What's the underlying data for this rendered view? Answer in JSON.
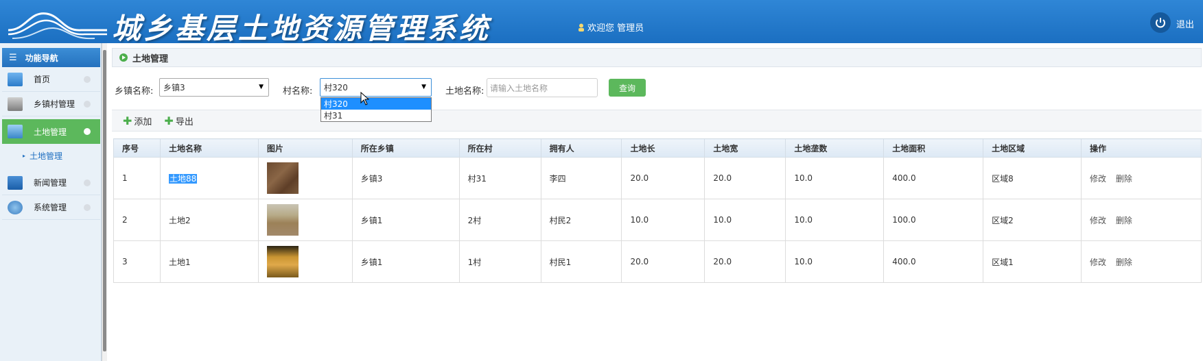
{
  "header": {
    "title": "城乡基层土地资源管理系统",
    "welcome": "欢迎您 管理员",
    "logout": "退出"
  },
  "sidebar": {
    "heading": "功能导航",
    "items": [
      {
        "label": "首页",
        "icon": "monitor-icon"
      },
      {
        "label": "乡镇村管理",
        "icon": "printer-icon"
      },
      {
        "label": "土地管理",
        "icon": "land-icon"
      },
      {
        "label": "新闻管理",
        "icon": "news-icon"
      },
      {
        "label": "系统管理",
        "icon": "settings-icon"
      }
    ],
    "sub_item": "土地管理"
  },
  "panel": {
    "title": "土地管理"
  },
  "filters": {
    "town_label": "乡镇名称:",
    "town_value": "乡镇3",
    "village_label": "村名称:",
    "village_value": "村320",
    "village_options": [
      "村320",
      "村31"
    ],
    "land_label": "土地名称:",
    "land_placeholder": "请输入土地名称",
    "query_button": "查询"
  },
  "toolbar": {
    "add": "添加",
    "export": "导出"
  },
  "table": {
    "columns": [
      "序号",
      "土地名称",
      "图片",
      "所在乡镇",
      "所在村",
      "拥有人",
      "土地长",
      "土地宽",
      "土地垄数",
      "土地面积",
      "土地区域",
      "操作"
    ],
    "rows": [
      {
        "no": "1",
        "name": "土地88",
        "town": "乡镇3",
        "village": "村31",
        "owner": "李四",
        "length": "20.0",
        "width": "20.0",
        "ridges": "10.0",
        "area": "400.0",
        "region": "区域8"
      },
      {
        "no": "2",
        "name": "土地2",
        "town": "乡镇1",
        "village": "2村",
        "owner": "村民2",
        "length": "10.0",
        "width": "10.0",
        "ridges": "10.0",
        "area": "100.0",
        "region": "区域2"
      },
      {
        "no": "3",
        "name": "土地1",
        "town": "乡镇1",
        "village": "1村",
        "owner": "村民1",
        "length": "20.0",
        "width": "20.0",
        "ridges": "10.0",
        "area": "400.0",
        "region": "区域1"
      }
    ],
    "edit_label": "修改",
    "delete_label": "删除"
  },
  "colors": {
    "header": "#1e74c6",
    "active": "#5cb85c",
    "selection": "#3399ff"
  }
}
